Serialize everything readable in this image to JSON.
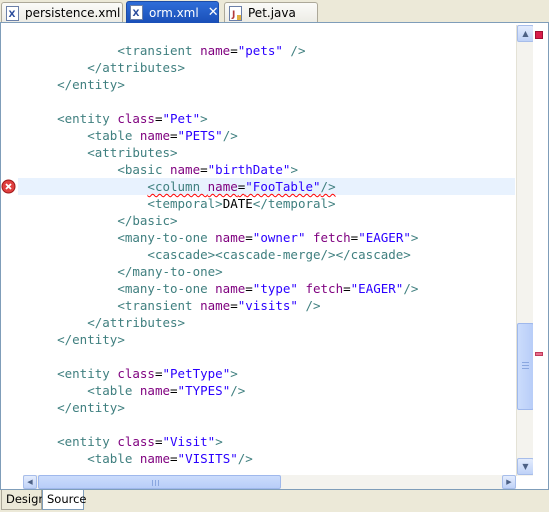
{
  "tabs": [
    {
      "label": "persistence.xml",
      "icon": "xml-file-icon",
      "active": false
    },
    {
      "label": "orm.xml",
      "icon": "xml-file-icon",
      "active": true,
      "close": "✕"
    },
    {
      "label": "Pet.java",
      "icon": "java-file-icon",
      "active": false
    }
  ],
  "editor": {
    "lines": [
      [
        [
          "            ",
          "x"
        ],
        [
          "<transient ",
          "t"
        ],
        [
          "name",
          "a"
        ],
        [
          "=",
          "x"
        ],
        [
          "\"pets\"",
          "v"
        ],
        [
          " />",
          "t"
        ]
      ],
      [
        [
          "        ",
          "x"
        ],
        [
          "</attributes>",
          "t"
        ]
      ],
      [
        [
          "    ",
          "x"
        ],
        [
          "</entity>",
          "t"
        ]
      ],
      [
        [
          "",
          "x"
        ]
      ],
      [
        [
          "    ",
          "x"
        ],
        [
          "<entity ",
          "t"
        ],
        [
          "class",
          "a"
        ],
        [
          "=",
          "x"
        ],
        [
          "\"Pet\"",
          "v"
        ],
        [
          ">",
          "t"
        ]
      ],
      [
        [
          "        ",
          "x"
        ],
        [
          "<table ",
          "t"
        ],
        [
          "name",
          "a"
        ],
        [
          "=",
          "x"
        ],
        [
          "\"PETS\"",
          "v"
        ],
        [
          "/>",
          "t"
        ]
      ],
      [
        [
          "        ",
          "x"
        ],
        [
          "<attributes>",
          "t"
        ]
      ],
      [
        [
          "            ",
          "x"
        ],
        [
          "<basic ",
          "t"
        ],
        [
          "name",
          "a"
        ],
        [
          "=",
          "x"
        ],
        [
          "\"birthDate\"",
          "v"
        ],
        [
          ">",
          "t"
        ]
      ],
      [
        [
          "                ",
          "x"
        ],
        [
          "<column ",
          "t",
          "err"
        ],
        [
          "name",
          "a",
          "err"
        ],
        [
          "=",
          "x",
          "err"
        ],
        [
          "\"FooTable\"",
          "v",
          "err"
        ],
        [
          "/>",
          "t",
          "err"
        ]
      ],
      [
        [
          "                ",
          "x"
        ],
        [
          "<temporal>",
          "t"
        ],
        [
          "DATE",
          "x"
        ],
        [
          "</temporal>",
          "t"
        ]
      ],
      [
        [
          "            ",
          "x"
        ],
        [
          "</basic>",
          "t"
        ]
      ],
      [
        [
          "            ",
          "x"
        ],
        [
          "<many-to-one ",
          "t"
        ],
        [
          "name",
          "a"
        ],
        [
          "=",
          "x"
        ],
        [
          "\"owner\"",
          "v"
        ],
        [
          " ",
          "x"
        ],
        [
          "fetch",
          "a"
        ],
        [
          "=",
          "x"
        ],
        [
          "\"EAGER\"",
          "v"
        ],
        [
          ">",
          "t"
        ]
      ],
      [
        [
          "                ",
          "x"
        ],
        [
          "<cascade>",
          "t"
        ],
        [
          "<cascade-merge/>",
          "t"
        ],
        [
          "</cascade>",
          "t"
        ]
      ],
      [
        [
          "            ",
          "x"
        ],
        [
          "</many-to-one>",
          "t"
        ]
      ],
      [
        [
          "            ",
          "x"
        ],
        [
          "<many-to-one ",
          "t"
        ],
        [
          "name",
          "a"
        ],
        [
          "=",
          "x"
        ],
        [
          "\"type\"",
          "v"
        ],
        [
          " ",
          "x"
        ],
        [
          "fetch",
          "a"
        ],
        [
          "=",
          "x"
        ],
        [
          "\"EAGER\"",
          "v"
        ],
        [
          "/>",
          "t"
        ]
      ],
      [
        [
          "            ",
          "x"
        ],
        [
          "<transient ",
          "t"
        ],
        [
          "name",
          "a"
        ],
        [
          "=",
          "x"
        ],
        [
          "\"visits\"",
          "v"
        ],
        [
          " />",
          "t"
        ]
      ],
      [
        [
          "        ",
          "x"
        ],
        [
          "</attributes>",
          "t"
        ]
      ],
      [
        [
          "    ",
          "x"
        ],
        [
          "</entity>",
          "t"
        ]
      ],
      [
        [
          "",
          "x"
        ]
      ],
      [
        [
          "    ",
          "x"
        ],
        [
          "<entity ",
          "t"
        ],
        [
          "class",
          "a"
        ],
        [
          "=",
          "x"
        ],
        [
          "\"PetType\"",
          "v"
        ],
        [
          ">",
          "t"
        ]
      ],
      [
        [
          "        ",
          "x"
        ],
        [
          "<table ",
          "t"
        ],
        [
          "name",
          "a"
        ],
        [
          "=",
          "x"
        ],
        [
          "\"TYPES\"",
          "v"
        ],
        [
          "/>",
          "t"
        ]
      ],
      [
        [
          "    ",
          "x"
        ],
        [
          "</entity>",
          "t"
        ]
      ],
      [
        [
          "",
          "x"
        ]
      ],
      [
        [
          "    ",
          "x"
        ],
        [
          "<entity ",
          "t"
        ],
        [
          "class",
          "a"
        ],
        [
          "=",
          "x"
        ],
        [
          "\"Visit\"",
          "v"
        ],
        [
          ">",
          "t"
        ]
      ],
      [
        [
          "        ",
          "x"
        ],
        [
          "<table ",
          "t"
        ],
        [
          "name",
          "a"
        ],
        [
          "=",
          "x"
        ],
        [
          "\"VISITS\"",
          "v"
        ],
        [
          "/>",
          "t"
        ]
      ]
    ],
    "current_line": 8,
    "error_line": 8,
    "error_marker_icon": "error-icon"
  },
  "bottom_tabs": [
    {
      "label": "Design",
      "active": false
    },
    {
      "label": "Source",
      "active": true
    }
  ],
  "colors": {
    "tag": "#3f7f7f",
    "attribute": "#7f007f",
    "value": "#2a00ff",
    "text": "#000000",
    "current_line": "#e8f2fe",
    "active_tab": "#2f6dd8",
    "error": "#ff0000"
  }
}
